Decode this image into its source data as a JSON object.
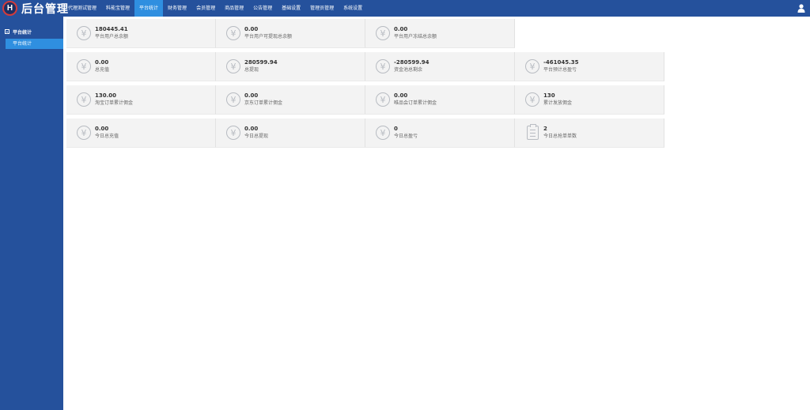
{
  "app": {
    "title": "后台管理",
    "logo_glyph": "H"
  },
  "nav": {
    "items": [
      {
        "label": "代理测试管理",
        "active": false
      },
      {
        "label": "料能宝管理",
        "active": false
      },
      {
        "label": "平台统计",
        "active": true
      },
      {
        "label": "财务管理",
        "active": false
      },
      {
        "label": "会员管理",
        "active": false
      },
      {
        "label": "商品管理",
        "active": false
      },
      {
        "label": "公告管理",
        "active": false
      },
      {
        "label": "基础设置",
        "active": false
      },
      {
        "label": "管理员管理",
        "active": false
      },
      {
        "label": "系统设置",
        "active": false
      }
    ]
  },
  "sidebar": {
    "group": {
      "label": "平台统计"
    },
    "items": [
      {
        "label": "平台统计",
        "active": true
      }
    ]
  },
  "stats": {
    "row0": [
      {
        "value": "180445.41",
        "label": "平台用户总余额",
        "icon": "yen-icon"
      },
      {
        "value": "0.00",
        "label": "平台用户可提现总余额",
        "icon": "yen-icon"
      },
      {
        "value": "0.00",
        "label": "平台用户冻结总余额",
        "icon": "yen-icon"
      }
    ],
    "row1": [
      {
        "value": "0.00",
        "label": "总充值",
        "icon": "yen-icon"
      },
      {
        "value": "280599.94",
        "label": "总提现",
        "icon": "yen-icon"
      },
      {
        "value": "-280599.94",
        "label": "资金池总剩余",
        "icon": "yen-icon"
      },
      {
        "value": "-461045.35",
        "label": "平台预计总盈亏",
        "icon": "yen-icon"
      }
    ],
    "row2": [
      {
        "value": "130.00",
        "label": "淘宝订单累计佣金",
        "icon": "yen-icon"
      },
      {
        "value": "0.00",
        "label": "京东订单累计佣金",
        "icon": "yen-icon"
      },
      {
        "value": "0.00",
        "label": "唯品会订单累计佣金",
        "icon": "yen-icon"
      },
      {
        "value": "130",
        "label": "累计发放佣金",
        "icon": "yen-icon"
      }
    ],
    "row3": [
      {
        "value": "0.00",
        "label": "今日总充值",
        "icon": "yen-icon"
      },
      {
        "value": "0.00",
        "label": "今日总提现",
        "icon": "yen-icon"
      },
      {
        "value": "0",
        "label": "今日总盈亏",
        "icon": "yen-icon"
      },
      {
        "value": "2",
        "label": "今日总抢单单数",
        "icon": "clipboard-icon"
      }
    ]
  },
  "colors": {
    "header_bg": "#25519c",
    "active_bg": "#2f8fe0",
    "card_bg": "#f3f3f3",
    "icon_gray": "#b8bcc2"
  }
}
